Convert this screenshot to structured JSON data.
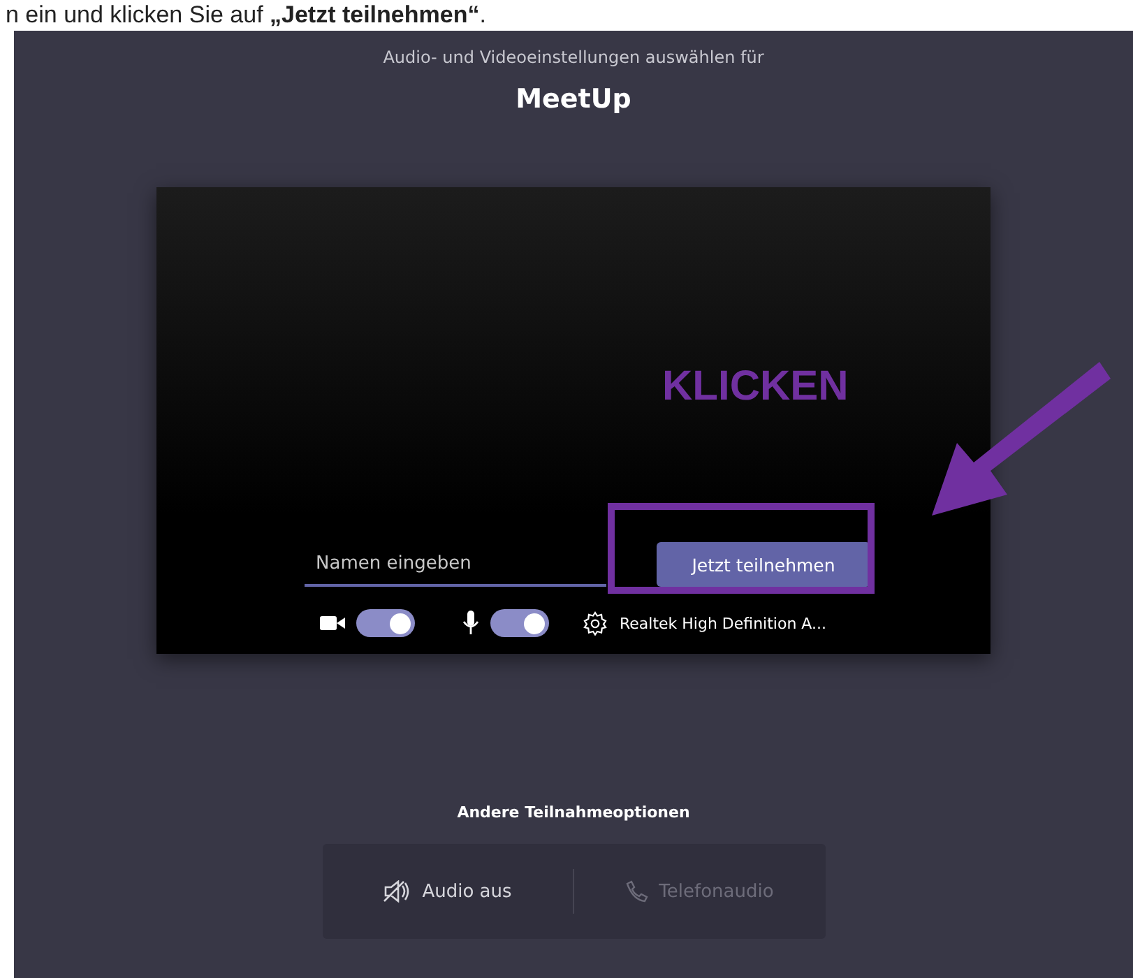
{
  "instruction": "n ein und klicken Sie auf **„Jetzt teilnehmen“**.",
  "header": {
    "subtitle": "Audio- und Videoeinstellungen auswählen für",
    "title": "MeetUp"
  },
  "preview": {
    "name_field": {
      "placeholder": "Namen eingeben"
    },
    "join_button": "Jetzt teilnehmen",
    "camera": {
      "on": true
    },
    "microphone": {
      "on": true
    },
    "device": "Realtek High Definition A..."
  },
  "annotation": {
    "label": "KLICKEN"
  },
  "other_options": {
    "title": "Andere Teilnahmeoptionen",
    "options": [
      {
        "kind": "audio-off",
        "label": "Audio aus",
        "disabled": false
      },
      {
        "kind": "phone",
        "label": "Telefonaudio",
        "disabled": true
      }
    ]
  }
}
